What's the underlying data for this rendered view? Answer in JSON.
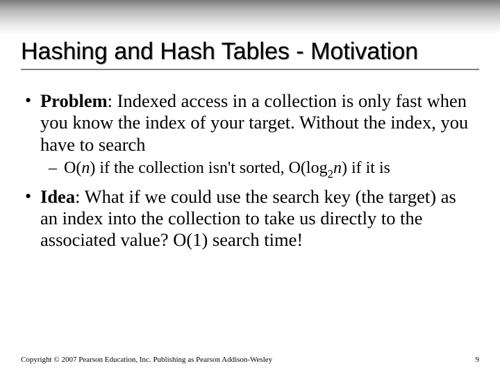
{
  "title": "Hashing and Hash Tables - Motivation",
  "bullets": {
    "problem": {
      "label": "Problem",
      "text": ": Indexed access in a collection is only fast when you know the index of your target. Without the index, you have to search"
    },
    "sub": {
      "pre": "O(",
      "n1": "n",
      "mid": ") if the collection isn't sorted, O(log",
      "sub2": "2",
      "n2": "n",
      "post": ") if it is"
    },
    "idea": {
      "label": "Idea",
      "text": ": What if we could use the search key (the target) as an index into the collection to take us directly to the associated value? O(1) search time!"
    }
  },
  "footer": "Copyright © 2007 Pearson Education, Inc. Publishing as Pearson Addison-Wesley",
  "page": "9"
}
